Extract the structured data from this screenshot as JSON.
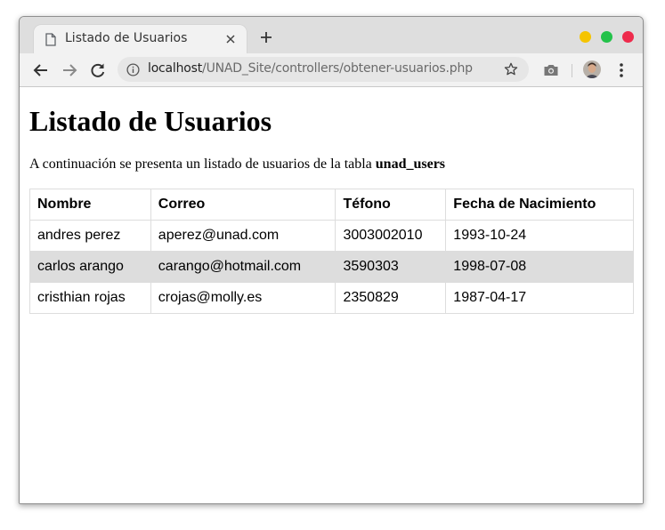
{
  "browser": {
    "tab_title": "Listado de Usuarios",
    "url_host": "localhost",
    "url_path": "/UNAD_Site/controllers/obtener-usuarios.php",
    "window_controls_colors": {
      "minimize": "#f5c400",
      "maximize": "#23c24a",
      "close": "#ee2b4c"
    },
    "icons": [
      "document-icon",
      "close-icon",
      "new-tab-icon",
      "back-icon",
      "forward-icon",
      "reload-icon",
      "info-icon",
      "star-icon",
      "camera-icon",
      "avatar",
      "menu-icon"
    ]
  },
  "page": {
    "heading": "Listado de Usuarios",
    "intro_text": "A continuación se presenta un listado de usuarios de la tabla ",
    "intro_table_name": "unad_users",
    "table": {
      "headers": [
        "Nombre",
        "Correo",
        "Téfono",
        "Fecha de Nacimiento"
      ],
      "rows": [
        [
          "andres perez",
          "aperez@unad.com",
          "3003002010",
          "1993-10-24"
        ],
        [
          "carlos arango",
          "carango@hotmail.com",
          "3590303",
          "1998-07-08"
        ],
        [
          "cristhian rojas",
          "crojas@molly.es",
          "2350829",
          "1987-04-17"
        ]
      ]
    }
  }
}
